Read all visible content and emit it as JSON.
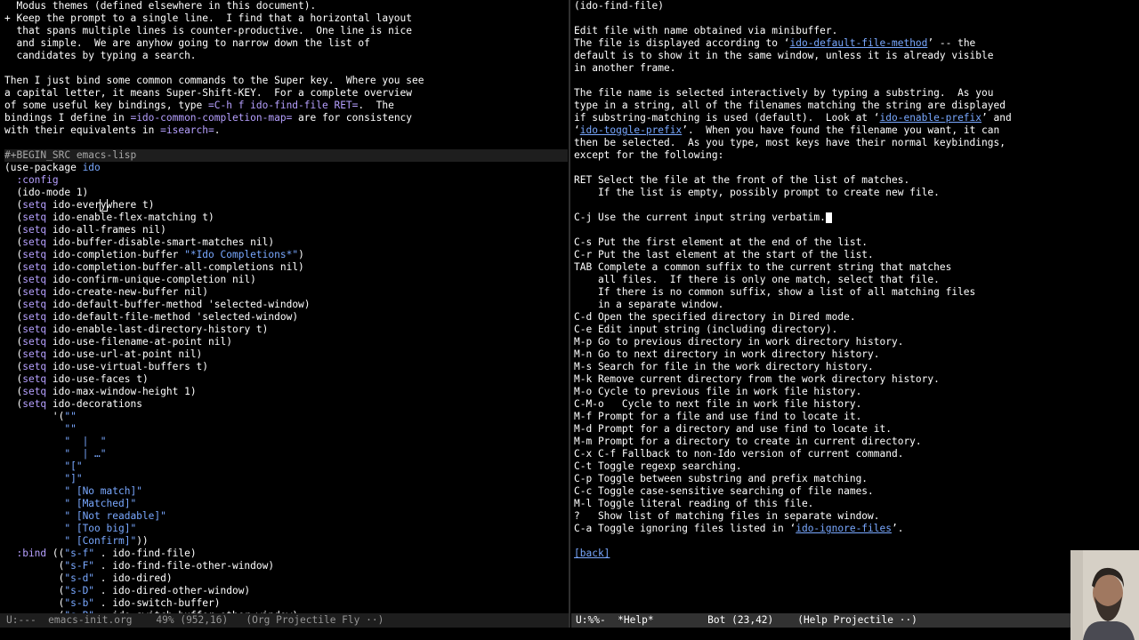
{
  "left": {
    "prose": [
      "  Modus themes (defined elsewhere in this document).",
      "+ Keep the prompt to a single line.  I find that a horizontal layout",
      "  that spans multiple lines is counter-productive.  One line is nice",
      "  and simple.  We are anyhow going to narrow down the list of",
      "  candidates by typing a search.",
      "",
      "Then I just bind some common commands to the Super key.  Where you see",
      "a capital letter, it means Super-Shift-KEY.  For a complete overview"
    ],
    "prose2_a": "of some useful key bindings, type ",
    "prose2_code": "=C-h f ido-find-file RET=",
    "prose2_b": ".  The",
    "prose3_a": "bindings I define in ",
    "prose3_code": "=ido-common-completion-map=",
    "prose3_b": " are for consistency",
    "prose4_a": "with their equivalents in ",
    "prose4_code": "=isearch=",
    "prose4_b": ".",
    "begin_src": "#+BEGIN_SRC emacs-lisp",
    "use_package": "(use-package ",
    "use_package_name": "ido",
    "config_kw": "  :config",
    "ido_mode": "  (ido-mode 1)",
    "setq": "setq",
    "everywhere_a": " ido-ever",
    "everywhere_cursor": "y",
    "everywhere_b": "where t)",
    "setqs": [
      {
        "pre": " ido-enable-flex-matching t)",
        "str": "",
        "post": ""
      },
      {
        "pre": " ido-all-frames nil)",
        "str": "",
        "post": ""
      },
      {
        "pre": " ido-buffer-disable-smart-matches nil)",
        "str": "",
        "post": ""
      },
      {
        "pre": " ido-completion-buffer ",
        "str": "\"*Ido Completions*\"",
        "post": ")"
      },
      {
        "pre": " ido-completion-buffer-all-completions nil)",
        "str": "",
        "post": ""
      },
      {
        "pre": " ido-confirm-unique-completion nil)",
        "str": "",
        "post": ""
      },
      {
        "pre": " ido-create-new-buffer nil)",
        "str": "",
        "post": ""
      },
      {
        "pre": " ido-default-buffer-method 'selected-window)",
        "str": "",
        "post": ""
      },
      {
        "pre": " ido-default-file-method 'selected-window)",
        "str": "",
        "post": ""
      },
      {
        "pre": " ido-enable-last-directory-history t)",
        "str": "",
        "post": ""
      },
      {
        "pre": " ido-use-filename-at-point nil)",
        "str": "",
        "post": ""
      },
      {
        "pre": " ido-use-url-at-point nil)",
        "str": "",
        "post": ""
      },
      {
        "pre": " ido-use-virtual-buffers t)",
        "str": "",
        "post": ""
      },
      {
        "pre": " ido-use-faces t)",
        "str": "",
        "post": ""
      },
      {
        "pre": " ido-max-window-height 1)",
        "str": "",
        "post": ""
      },
      {
        "pre": " ido-decorations",
        "str": "",
        "post": ""
      }
    ],
    "decorations": [
      {
        "pad": "        '(",
        "str": "\"\"",
        "post": ""
      },
      {
        "pad": "          ",
        "str": "\"\"",
        "post": ""
      },
      {
        "pad": "          ",
        "str": "\"  |  \"",
        "post": ""
      },
      {
        "pad": "          ",
        "str": "\"  | …\"",
        "post": ""
      },
      {
        "pad": "          ",
        "str": "\"[\"",
        "post": ""
      },
      {
        "pad": "          ",
        "str": "\"]\"",
        "post": ""
      },
      {
        "pad": "          ",
        "str": "\" [No match]\"",
        "post": ""
      },
      {
        "pad": "          ",
        "str": "\" [Matched]\"",
        "post": ""
      },
      {
        "pad": "          ",
        "str": "\" [Not readable]\"",
        "post": ""
      },
      {
        "pad": "          ",
        "str": "\" [Too big]\"",
        "post": ""
      },
      {
        "pad": "          ",
        "str": "\" [Confirm]\"",
        "post": "))"
      }
    ],
    "bind_kw": "  :bind",
    "binds": [
      {
        "pad": " ((",
        "key": "\"s-f\"",
        "cmd": " . ido-find-file)"
      },
      {
        "pad": "         (",
        "key": "\"s-F\"",
        "cmd": " . ido-find-file-other-window)"
      },
      {
        "pad": "         (",
        "key": "\"s-d\"",
        "cmd": " . ido-dired)"
      },
      {
        "pad": "         (",
        "key": "\"s-D\"",
        "cmd": " . ido-dired-other-window)"
      },
      {
        "pad": "         (",
        "key": "\"s-b\"",
        "cmd": " . ido-switch-buffer)"
      },
      {
        "pad": "         (",
        "key": "\"s-B\"",
        "cmd": " . ido-switch-buffer-other-window)"
      }
    ]
  },
  "right": {
    "title": "(ido-find-file)",
    "lines_1": [
      "",
      "Edit file with name obtained via minibuffer."
    ],
    "l_display_a": "The file is displayed according to ‘",
    "l_display_link": "ido-default-file-method",
    "l_display_b": "’ -- the",
    "lines_2": [
      "default is to show it in the same window, unless it is already visible",
      "in another frame.",
      "",
      "The file name is selected interactively by typing a substring.  As you",
      "type in a string, all of the filenames matching the string are displayed"
    ],
    "l_prefix_a": "if substring-matching is used (default).  Look at ‘",
    "l_prefix_link": "ido-enable-prefix",
    "l_prefix_b": "’ and",
    "l_toggle_a": "‘",
    "l_toggle_link": "ido-toggle-prefix",
    "l_toggle_b": "’.  When you have found the filename you want, it can",
    "lines_3": [
      "then be selected.  As you type, most keys have their normal keybindings,",
      "except for the following:",
      "",
      "RET Select the file at the front of the list of matches.",
      "    If the list is empty, possibly prompt to create new file.",
      ""
    ],
    "cj_line": "C-j Use the current input string verbatim.",
    "lines_4": [
      "",
      "C-s Put the first element at the end of the list.",
      "C-r Put the last element at the start of the list.",
      "TAB Complete a common suffix to the current string that matches",
      "    all files.  If there is only one match, select that file.",
      "    If there is no common suffix, show a list of all matching files",
      "    in a separate window.",
      "C-d Open the specified directory in Dired mode.",
      "C-e Edit input string (including directory).",
      "M-p Go to previous directory in work directory history.",
      "M-n Go to next directory in work directory history.",
      "M-s Search for file in the work directory history.",
      "M-k Remove current directory from the work directory history.",
      "M-o Cycle to previous file in work file history.",
      "C-M-o   Cycle to next file in work file history.",
      "M-f Prompt for a file and use find to locate it.",
      "M-d Prompt for a directory and use find to locate it.",
      "M-m Prompt for a directory to create in current directory.",
      "C-x C-f Fallback to non-Ido version of current command.",
      "C-t Toggle regexp searching.",
      "C-p Toggle between substring and prefix matching.",
      "C-c Toggle case-sensitive searching of file names.",
      "M-l Toggle literal reading of this file.",
      "?   Show list of matching files in separate window."
    ],
    "l_ignore_a": "C-a Toggle ignoring files listed in ‘",
    "l_ignore_link": "ido-ignore-files",
    "l_ignore_b": "’.",
    "back_link": "[back]"
  },
  "modeline_left": "U:---  emacs-init.org    49% (952,16)   (Org Projectile Fly ··)",
  "modeline_right": "U:%%-  *Help*         Bot (23,42)    (Help Projectile ··)",
  "colors": {
    "background": "#000000",
    "foreground": "#ffffff",
    "keyword": "#b6a0ff",
    "string": "#79a8ff",
    "link": "#79a8ff"
  }
}
